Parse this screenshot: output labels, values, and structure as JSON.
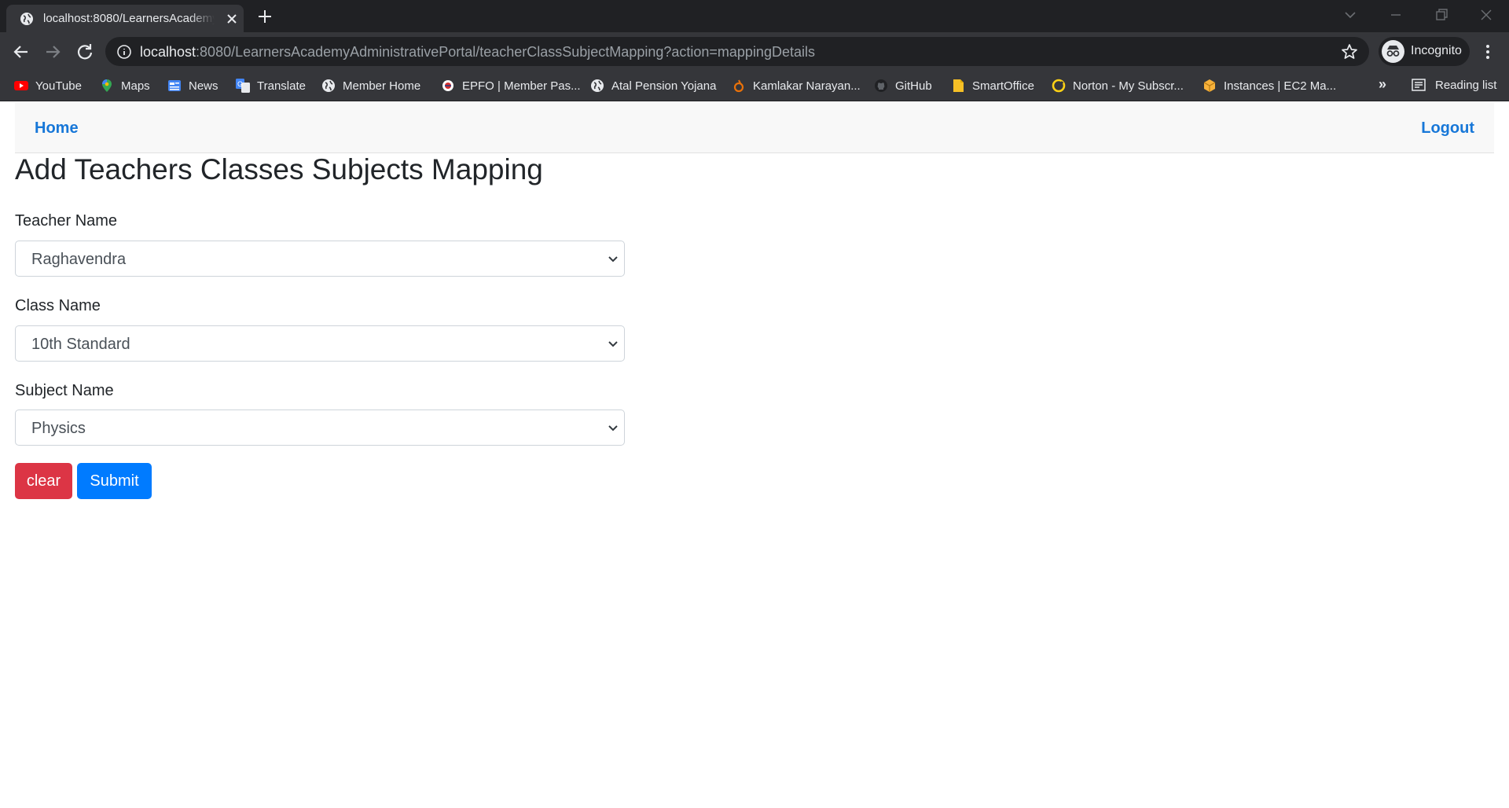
{
  "browser": {
    "tab_title": "localhost:8080/LearnersAcademy",
    "url_host": "localhost",
    "url_rest": ":8080/LearnersAcademyAdministrativePortal/teacherClassSubjectMapping?action=mappingDetails",
    "profile_label": "Incognito",
    "bookmarks": [
      {
        "label": "YouTube",
        "icon": "youtube-icon"
      },
      {
        "label": "Maps",
        "icon": "maps-icon"
      },
      {
        "label": "News",
        "icon": "news-icon"
      },
      {
        "label": "Translate",
        "icon": "translate-icon"
      },
      {
        "label": "Member Home",
        "icon": "globe-icon"
      },
      {
        "label": "EPFO | Member Pas...",
        "icon": "epfo-icon"
      },
      {
        "label": "Atal Pension Yojana",
        "icon": "globe-icon"
      },
      {
        "label": "Kamlakar Narayan...",
        "icon": "bookmark-site-icon"
      },
      {
        "label": "GitHub",
        "icon": "github-icon"
      },
      {
        "label": "SmartOffice",
        "icon": "smartoffice-icon"
      },
      {
        "label": "Norton - My Subscr...",
        "icon": "norton-icon"
      },
      {
        "label": "Instances | EC2 Ma...",
        "icon": "aws-icon"
      }
    ],
    "more_bookmarks": "»",
    "reading_list": "Reading list"
  },
  "nav": {
    "home": "Home",
    "logout": "Logout"
  },
  "form": {
    "title": "Add Teachers Classes Subjects Mapping",
    "teacher_label": "Teacher Name",
    "teacher_value": "Raghavendra",
    "class_label": "Class Name",
    "class_value": "10th Standard",
    "subject_label": "Subject Name",
    "subject_value": "Physics",
    "clear_label": "clear",
    "submit_label": "Submit"
  },
  "colors": {
    "link": "#1777d8",
    "clear_button": "#dc3545",
    "submit_button": "#007bff"
  }
}
